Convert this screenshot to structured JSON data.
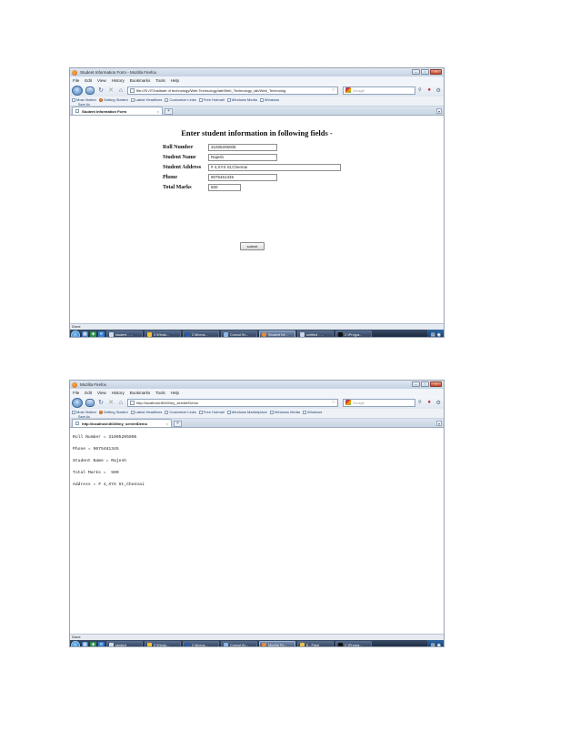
{
  "menu": [
    "File",
    "Edit",
    "View",
    "History",
    "Bookmarks",
    "Tools",
    "Help"
  ],
  "screen1": {
    "window_title": "Student Information Form - Mozilla Firefox",
    "url": "file:///D:/IT/Institute of technology/Web Technology/lab/Web_Technology_lab/Web_Technolog",
    "search_placeholder": "Google",
    "bookmarks": [
      "Most Visited",
      "Getting Started",
      "Latest Headlines",
      "Customize Links",
      "Free Hotmail",
      "Windows Media",
      "Windows"
    ],
    "save_label": "Save As",
    "tab_title": "Student Information Form",
    "form": {
      "heading": "Enter student information in following fields -",
      "fields": [
        {
          "label": "Roll Number",
          "value": "31005205005"
        },
        {
          "label": "Student Name",
          "value": "Rajesh"
        },
        {
          "label": "Student Address",
          "value": "# 4,XYX St,Chennai"
        },
        {
          "label": "Phone",
          "value": "9075461345"
        },
        {
          "label": "Total Marks",
          "value": "500"
        }
      ],
      "submit_label": "submit"
    },
    "status": "Done",
    "taskbar": [
      "student - ...",
      "3 Windo...",
      "2 Micros...",
      "Connot fin...",
      "Student Inf...",
      "untitled - ...",
      "C:\\Progra..."
    ]
  },
  "screen2": {
    "window_title": "Mozilla Firefox",
    "url": "http://localhost:8040/my_servlet/Demo",
    "search_placeholder": "Google",
    "bookmarks": [
      "Most Visited",
      "Getting Started",
      "Latest Headlines",
      "Customize Links",
      "Free Hotmail",
      "Windows Marketplace",
      "Windows Media",
      "Windows"
    ],
    "save_label": "Save As",
    "tab_title": "http://localhost:8040/my_servletDemo",
    "output": [
      "Roll Number = 31005205005",
      "Phone = 9075461345",
      "Student Name = Rajesh",
      "Total Marks =  500",
      "Address = # 4,XYX St,Chennai"
    ],
    "status": "Done",
    "taskbar": [
      "student",
      "3 Windo...",
      "2 Micros...",
      "Connot fin...",
      "Mozilla Fir...",
      "6 - Paint",
      "C:\\Progra..."
    ]
  },
  "colors": {
    "taskbar": "#1a2a44",
    "titlebar": "#c4d2e3",
    "accent": "#3c6a9a"
  }
}
